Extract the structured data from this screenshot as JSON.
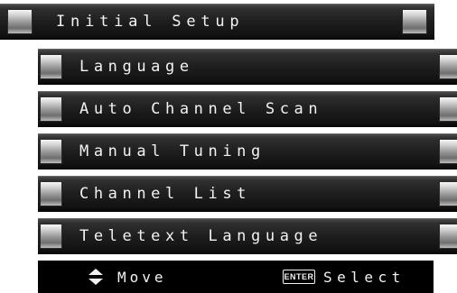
{
  "header": {
    "title": "Initial Setup"
  },
  "menu": {
    "items": [
      {
        "label": "Language"
      },
      {
        "label": "Auto Channel Scan"
      },
      {
        "label": "Manual Tuning"
      },
      {
        "label": "Channel List"
      },
      {
        "label": "Teletext Language"
      }
    ]
  },
  "footer": {
    "move_icon": "up-down-arrows-icon",
    "move_label": "Move",
    "enter_key_label": "ENTER",
    "select_label": "Select"
  },
  "colors": {
    "background": "#ffffff",
    "bar": "#1e1e1e",
    "text": "#f2f2f2",
    "footer": "#000000"
  }
}
